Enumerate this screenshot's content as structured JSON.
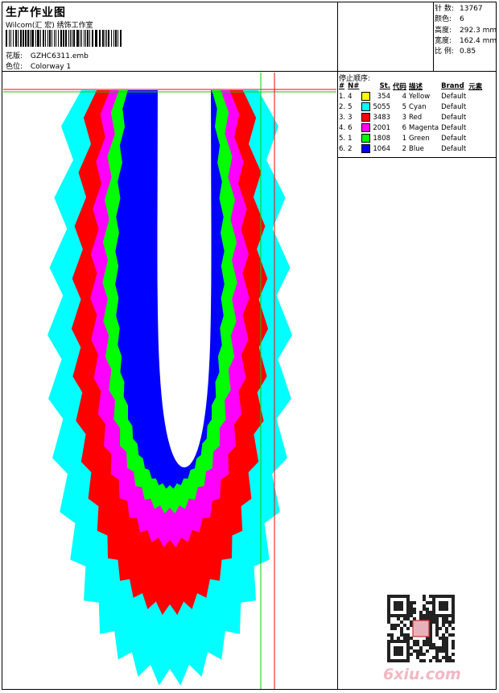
{
  "header": {
    "title": "生产作业图",
    "subtitle": "Wilcom(汇 宏) 绣饰工作室",
    "pattern_label": "花版:",
    "pattern_value": "GZHC6311.emb",
    "colorway_label": "色位:",
    "colorway_value": "Colorway 1"
  },
  "stats": [
    {
      "label": "针 数:",
      "value": "13767"
    },
    {
      "label": "颜色:",
      "value": "6"
    },
    {
      "label": "高度:",
      "value": "292.3 mm"
    },
    {
      "label": "宽度:",
      "value": "162.4 mm"
    },
    {
      "label": "比 例:",
      "value": "0.85"
    }
  ],
  "stop_sequence": {
    "title": "停止顺序:",
    "headers": [
      "#",
      "N#",
      "St.",
      "代码",
      "描述",
      "Brand",
      "元素"
    ],
    "rows": [
      {
        "idx": "1.",
        "n": "4",
        "st": "354",
        "code": "4",
        "desc": "Yellow",
        "brand": "Default",
        "color": "#ffff00"
      },
      {
        "idx": "2.",
        "n": "5",
        "st": "5055",
        "code": "5",
        "desc": "Cyan",
        "brand": "Default",
        "color": "#00ffff"
      },
      {
        "idx": "3.",
        "n": "3",
        "st": "3483",
        "code": "3",
        "desc": "Red",
        "brand": "Default",
        "color": "#ff0000"
      },
      {
        "idx": "4.",
        "n": "6",
        "st": "2001",
        "code": "6",
        "desc": "Magenta",
        "brand": "Default",
        "color": "#ff00ff"
      },
      {
        "idx": "5.",
        "n": "1",
        "st": "1808",
        "code": "1",
        "desc": "Green",
        "brand": "Default",
        "color": "#00ff00"
      },
      {
        "idx": "6.",
        "n": "2",
        "st": "1064",
        "code": "2",
        "desc": "Blue",
        "brand": "Default",
        "color": "#0000ff"
      }
    ]
  },
  "markers": {
    "h1": "1",
    "h2": "2",
    "v1": "1",
    "v2": "2"
  },
  "watermark": "6xiu.com",
  "colors": {
    "cyan": "#00ffff",
    "red": "#ff0000",
    "magenta": "#ff00ff",
    "green": "#00ff00",
    "blue": "#0000ff",
    "guide_red": "#ff0000",
    "guide_green": "#00cc00"
  }
}
